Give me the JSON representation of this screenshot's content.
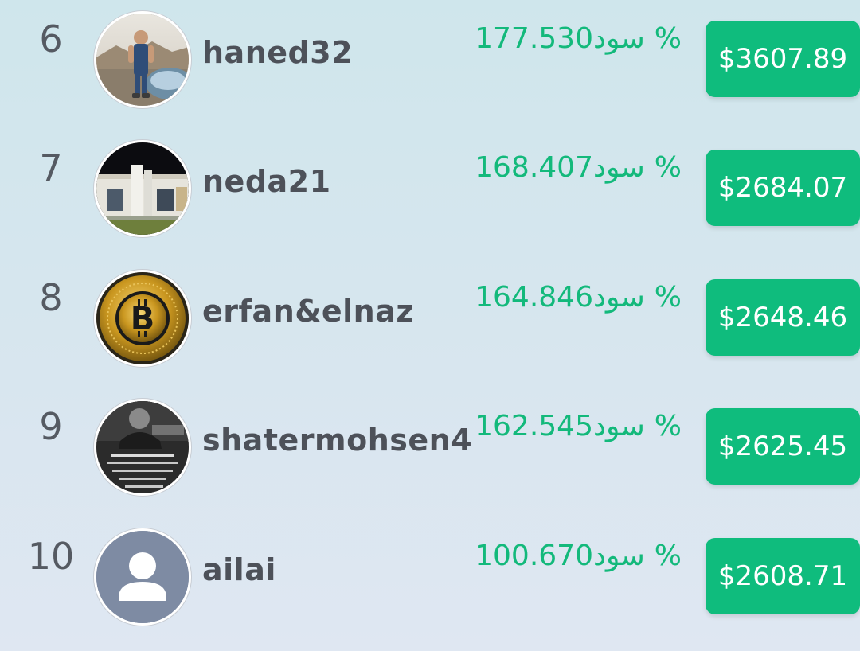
{
  "leaderboard": {
    "rows": [
      {
        "rank": "6",
        "username": "haned32",
        "profit_word": "سود",
        "profit_pct": "177.530%",
        "amount": "$3607.89",
        "avatar": "photo-child-on-car"
      },
      {
        "rank": "7",
        "username": "neda21",
        "profit_word": "سود",
        "profit_pct": "168.407%",
        "amount": "$2684.07",
        "avatar": "photo-building-night"
      },
      {
        "rank": "8",
        "username": "erfan&elnaz",
        "profit_word": "سود",
        "profit_pct": "164.846%",
        "amount": "$2648.46",
        "avatar": "bitcoin-coin"
      },
      {
        "rank": "9",
        "username": "shatermohsen4",
        "profit_word": "سود",
        "profit_pct": "162.545%",
        "amount": "$2625.45",
        "avatar": "photo-man-with-persian-text"
      },
      {
        "rank": "10",
        "username": "ailai",
        "profit_word": "سود",
        "profit_pct": "100.670%",
        "amount": "$2608.71",
        "avatar": "default-user-icon"
      }
    ],
    "colors": {
      "accent": "#0fbc7d",
      "profit_text": "#13b97b",
      "rank_text": "#555a62",
      "username_text": "#4d5159",
      "default_avatar_bg": "#7e8ba3"
    }
  }
}
